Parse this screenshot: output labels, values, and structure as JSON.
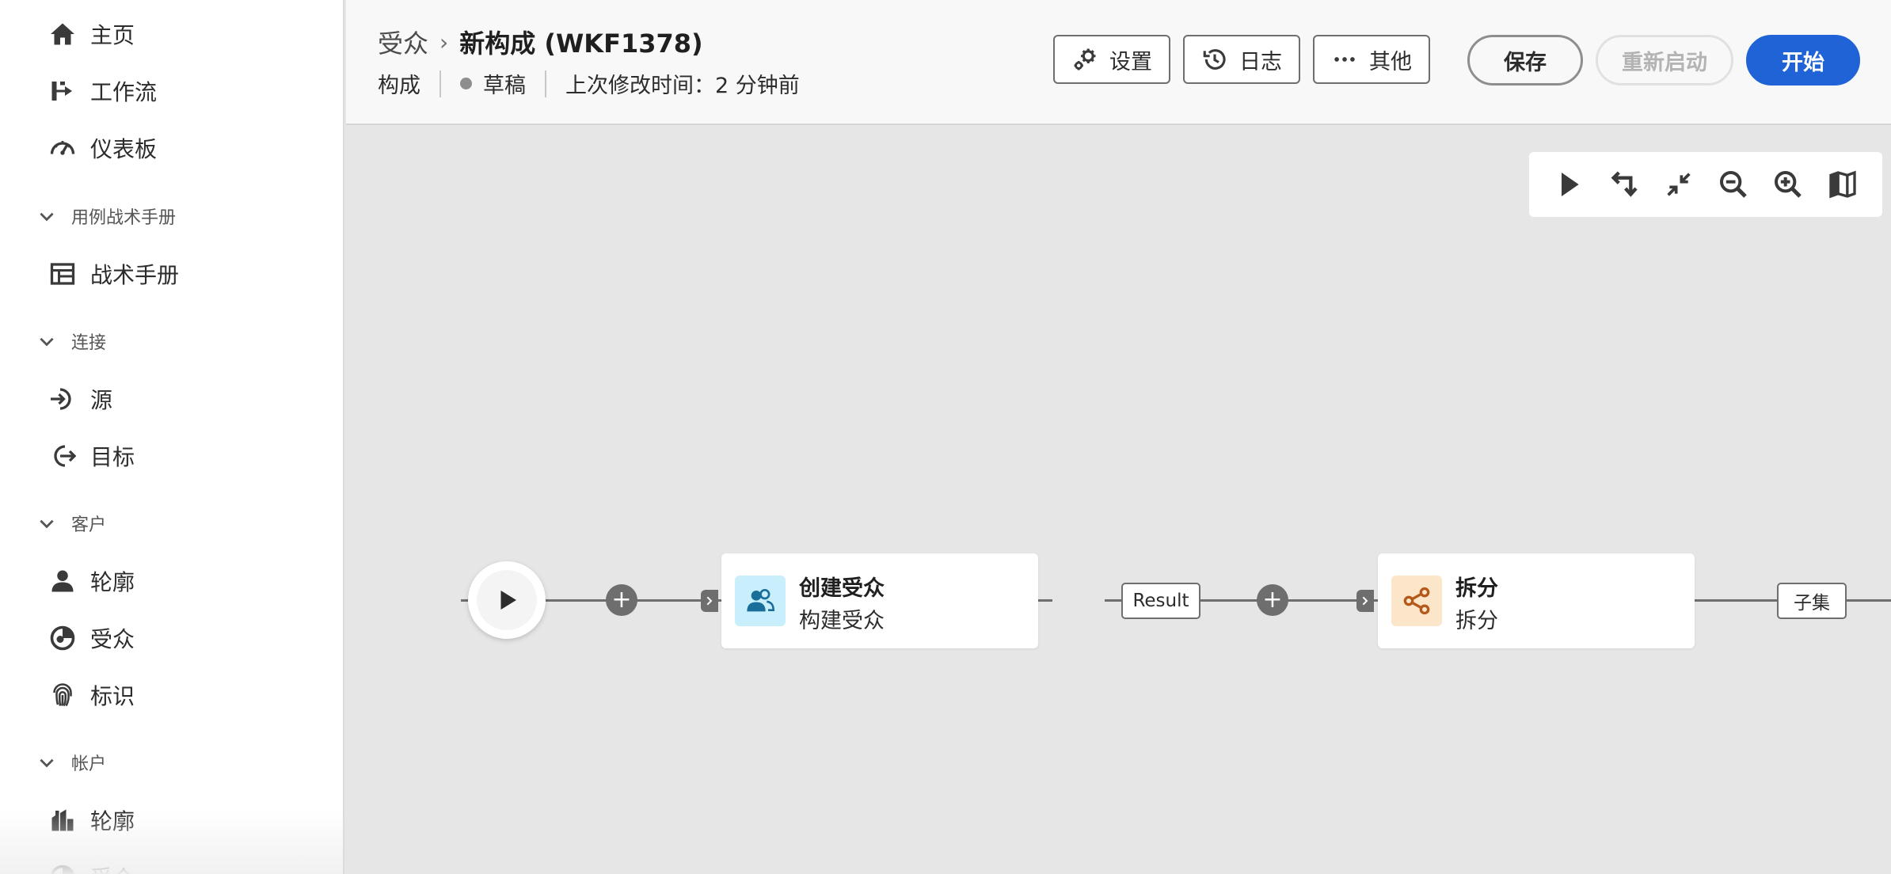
{
  "sidebar": {
    "items": {
      "home": "主页",
      "workflows": "工作流",
      "dashboards": "仪表板",
      "playbooks": "战术手册",
      "sources": "源",
      "destinations": "目标",
      "customer_profiles": "轮廓",
      "customer_audiences": "受众",
      "identities": "标识",
      "account_profiles": "轮廓",
      "account_audiences": "受众"
    },
    "sections": {
      "playbooks": "用例战术手册",
      "connections": "连接",
      "customer": "客户",
      "account": "帐户"
    }
  },
  "header": {
    "breadcrumb_parent": "受众",
    "breadcrumb_separator": "›",
    "title": "新构成 (WKF1378)",
    "type": "构成",
    "status": "草稿",
    "last_modified": "上次修改时间：2 分钟前"
  },
  "toolbar_buttons": {
    "settings": "设置",
    "logs": "日志",
    "more": "其他",
    "save": "保存",
    "restart": "重新启动",
    "start": "开始"
  },
  "canvas": {
    "zoom_tools": [
      "select-icon",
      "undo-redo-icon",
      "collapse-icon",
      "zoom-out-icon",
      "zoom-in-icon",
      "map-icon"
    ],
    "nodes": [
      {
        "title": "创建受众",
        "subtitle": "构建受众",
        "icon": "audience-icon",
        "icon_bg": "#c8effb",
        "icon_color": "#1a6f9a"
      },
      {
        "title": "拆分",
        "subtitle": "拆分",
        "icon": "split-icon",
        "icon_bg": "#fbe6c9",
        "icon_color": "#b4581b"
      }
    ],
    "transition_labels": [
      "Result",
      "子集"
    ],
    "add_symbol": "+"
  },
  "colors": {
    "primary_button": "#1f63d6",
    "canvas_bg": "#e6e6e6",
    "wire": "#6e6e6e"
  }
}
